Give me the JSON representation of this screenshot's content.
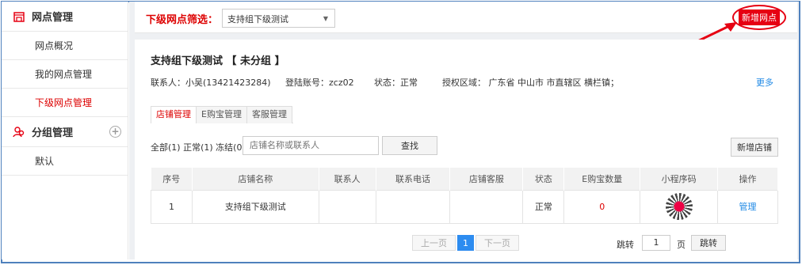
{
  "sidebar": {
    "group1": {
      "label": "网点管理",
      "icon": "store-icon"
    },
    "items": [
      {
        "label": "网点概况",
        "active": false
      },
      {
        "label": "我的网点管理",
        "active": false
      },
      {
        "label": "下级网点管理",
        "active": true
      }
    ],
    "group2": {
      "label": "分组管理",
      "icon": "users-icon",
      "add_icon": "plus-circle-icon"
    },
    "group_items": [
      {
        "label": "默认"
      }
    ]
  },
  "topbar": {
    "filter_label": "下级网点筛选：",
    "filter_value": "支持组下级测试",
    "new_point_button": "新增网点"
  },
  "detail": {
    "title": "支持组下级测试 【 未分组 】",
    "contact": "联系人：小吴(13421423284)",
    "account": "登陆账号：zcz02",
    "status": "状态：正常",
    "region": "授权区域： 广东省 中山市 市直辖区 横栏镇；",
    "more": "更多"
  },
  "tabs": [
    {
      "label": "店铺管理",
      "active": true
    },
    {
      "label": "E购宝管理",
      "active": false
    },
    {
      "label": "客服管理",
      "active": false
    }
  ],
  "filters": {
    "counts": "全部(1) 正常(1) 冻结(0)",
    "search_placeholder": "店铺名称或联系人",
    "search_button": "查找",
    "new_shop_button": "新增店铺"
  },
  "table": {
    "headers": [
      "序号",
      "店铺名称",
      "联系人",
      "联系电话",
      "店铺客服",
      "状态",
      "E购宝数量",
      "小程序码",
      "操作"
    ],
    "rows": [
      {
        "index": "1",
        "name": "支持组下级测试",
        "contact": "",
        "phone": "",
        "service": "",
        "status": "正常",
        "count": "0",
        "action": "管理"
      }
    ]
  },
  "pager": {
    "prev": "上一页",
    "current": "1",
    "next": "下一页",
    "jump_label": "跳转",
    "page_value": "1",
    "page_unit": "页",
    "jump_button": "跳转"
  },
  "colors": {
    "accent_red": "#e60012",
    "link_blue": "#1e88e5",
    "frame_blue": "#4f81bd"
  }
}
